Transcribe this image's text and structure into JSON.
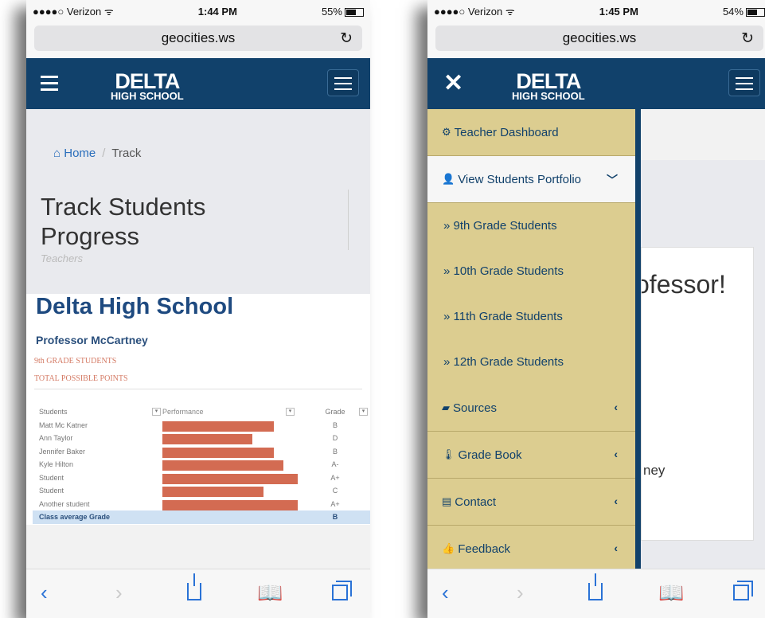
{
  "left": {
    "status": {
      "carrier": "●●●●○ Verizon ᯤ",
      "time": "1:44 PM",
      "battery": "55%",
      "battery_level": 0.55
    },
    "url": "geocities.ws",
    "logo": {
      "line1": "DELTA",
      "line2": "HIGH SCHOOL"
    },
    "breadcrumb": {
      "home": "Home",
      "separator": "/",
      "current": "Track"
    },
    "page_title": "Track Students Progress",
    "page_subtitle": "Teachers",
    "school_title": "Delta High School",
    "professor": "Professor McCartney",
    "grade_label": "9th GRADE STUDENTS",
    "points_label": "TOTAL POSSIBLE POINTS",
    "table": {
      "headers": [
        "Students",
        "Performance",
        "Grade"
      ],
      "rows": [
        {
          "name": "Matt Mc Katner",
          "performance": 0.72,
          "grade": "B"
        },
        {
          "name": "Ann Taylor",
          "performance": 0.58,
          "grade": "D"
        },
        {
          "name": "Jennifer Baker",
          "performance": 0.72,
          "grade": "B"
        },
        {
          "name": "Kyle Hilton",
          "performance": 0.78,
          "grade": "A-"
        },
        {
          "name": "Student",
          "performance": 0.87,
          "grade": "A+"
        },
        {
          "name": "Student",
          "performance": 0.65,
          "grade": "C"
        },
        {
          "name": "Another student",
          "performance": 0.87,
          "grade": "A+"
        }
      ],
      "average_label": "Class average Grade",
      "average_grade": "B"
    }
  },
  "right": {
    "status": {
      "carrier": "●●●●○ Verizon ᯤ",
      "time": "1:45 PM",
      "battery": "54%",
      "battery_level": 0.54
    },
    "url": "geocities.ws",
    "logo": {
      "line1": "DELTA",
      "line2": "HIGH SCHOOL"
    },
    "background_text": "ofessor!",
    "background_text2": "ney",
    "menu": [
      {
        "icon": "dashboard-icon",
        "glyph": "⚙",
        "label": "Teacher Dashboard",
        "chevron": ""
      },
      {
        "icon": "user-icon",
        "glyph": "👤",
        "label": "View Students Portfolio",
        "chevron": "﹀",
        "active": true
      },
      {
        "label": "» 9th Grade Students",
        "sub": true
      },
      {
        "label": "» 10th Grade Students",
        "sub": true
      },
      {
        "label": "» 11th Grade Students",
        "sub": true
      },
      {
        "label": "» 12th Grade Students",
        "sub": true
      },
      {
        "icon": "folder-open-icon",
        "glyph": "▰",
        "label": "Sources",
        "chevron": "‹"
      },
      {
        "icon": "thermometer-icon",
        "glyph": "🌡",
        "label": "Grade Book",
        "chevron": "‹"
      },
      {
        "icon": "contact-card-icon",
        "glyph": "▤",
        "label": "Contact",
        "chevron": "‹"
      },
      {
        "icon": "thumbs-up-icon",
        "glyph": "👍",
        "label": "Feedback",
        "chevron": "‹"
      }
    ]
  },
  "toolbar_icons": [
    "back-icon",
    "forward-icon",
    "share-icon",
    "bookmarks-icon",
    "tabs-icon"
  ],
  "colors": {
    "navbar": "#11416b",
    "drawer": "#dccd90",
    "bar": "#d36b52",
    "link": "#2a6ebb"
  }
}
